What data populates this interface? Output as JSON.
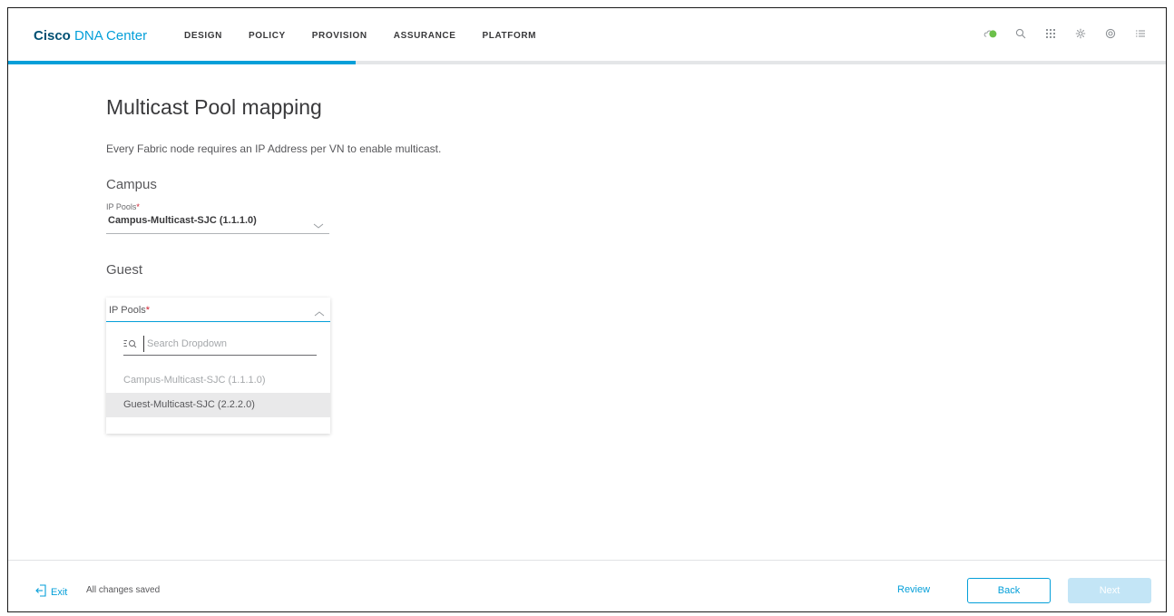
{
  "brand": {
    "bold": "Cisco",
    "rest": "DNA Center"
  },
  "nav": [
    {
      "label": "DESIGN"
    },
    {
      "label": "POLICY"
    },
    {
      "label": "PROVISION"
    },
    {
      "label": "ASSURANCE"
    },
    {
      "label": "PLATFORM"
    }
  ],
  "header_icons": [
    "cloud-status-icon",
    "search-icon",
    "apps-grid-icon",
    "gear-icon",
    "help-icon",
    "menu-icon"
  ],
  "colors": {
    "accent": "#049fd9",
    "status_ok": "#6cc04a",
    "required": "#cf2030"
  },
  "wizard_progress": 0.3,
  "page": {
    "title": "Multicast Pool mapping",
    "description": "Every Fabric node requires an IP Address per VN to enable multicast."
  },
  "campus": {
    "title": "Campus",
    "field_label": "IP Pools",
    "required_mark": "*",
    "selected_value": "Campus-Multicast-SJC (1.1.1.0)"
  },
  "guest": {
    "title": "Guest",
    "field_label": "IP Pools",
    "required_mark": "*",
    "search_placeholder": "Search Dropdown",
    "options": [
      {
        "label": "Campus-Multicast-SJC (1.1.1.0)",
        "state": "disabled"
      },
      {
        "label": "Guest-Multicast-SJC (2.2.2.0)",
        "state": "hover"
      }
    ]
  },
  "footer": {
    "exit_label": "Exit",
    "save_status": "All changes saved",
    "review_label": "Review",
    "back_label": "Back",
    "next_label": "Next"
  }
}
